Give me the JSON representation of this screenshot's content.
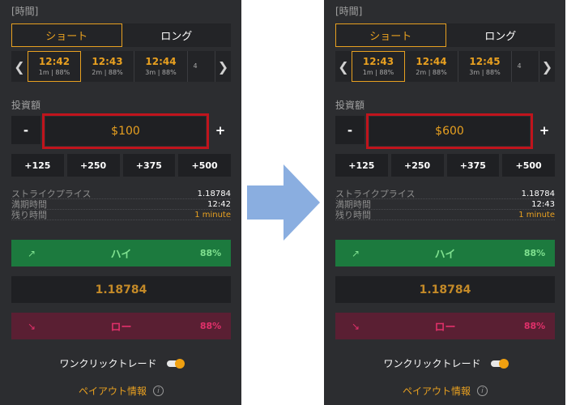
{
  "colors": {
    "panel_bg": "#2c2d30",
    "accent_orange": "#e8a020",
    "high_green": "#1c7a3e",
    "low_red": "#5a1f33",
    "highlight_red": "#c0141c",
    "arrow_blue": "#8aaee0"
  },
  "left": {
    "section_title": "[時間]",
    "tabs": {
      "short": "ショート",
      "long": "ロング"
    },
    "times": [
      {
        "time": "12:42",
        "sub": "1m | 88%"
      },
      {
        "time": "12:43",
        "sub": "2m | 88%"
      },
      {
        "time": "12:44",
        "sub": "3m | 88%"
      },
      {
        "time": "",
        "sub": "4"
      }
    ],
    "invest_label": "投資額",
    "minus": "-",
    "plus": "+",
    "amount": "$100",
    "quick": [
      "+125",
      "+250",
      "+375",
      "+500"
    ],
    "info": [
      {
        "label": "ストライクプライス",
        "value": "1.18784"
      },
      {
        "label": "満期時間",
        "value": "12:42"
      },
      {
        "label": "残り時間",
        "value": "1 minute"
      }
    ],
    "high": {
      "icon": "↗",
      "label": "ハイ",
      "pct": "88%"
    },
    "price": "1.18784",
    "low": {
      "icon": "↘",
      "label": "ロー",
      "pct": "88%"
    },
    "oneclick_label": "ワンクリックトレード",
    "payout_label": "ペイアウト情報",
    "info_glyph": "i"
  },
  "right": {
    "section_title": "[時間]",
    "tabs": {
      "short": "ショート",
      "long": "ロング"
    },
    "times": [
      {
        "time": "12:43",
        "sub": "1m | 88%"
      },
      {
        "time": "12:44",
        "sub": "2m | 88%"
      },
      {
        "time": "12:45",
        "sub": "3m | 88%"
      },
      {
        "time": "",
        "sub": "4"
      }
    ],
    "invest_label": "投資額",
    "minus": "-",
    "plus": "+",
    "amount": "$600",
    "quick": [
      "+125",
      "+250",
      "+375",
      "+500"
    ],
    "info": [
      {
        "label": "ストライクプライス",
        "value": "1.18784"
      },
      {
        "label": "満期時間",
        "value": "12:43"
      },
      {
        "label": "残り時間",
        "value": "1 minute"
      }
    ],
    "high": {
      "icon": "↗",
      "label": "ハイ",
      "pct": "88%"
    },
    "price": "1.18784",
    "low": {
      "icon": "↘",
      "label": "ロー",
      "pct": "88%"
    },
    "oneclick_label": "ワンクリックトレード",
    "payout_label": "ペイアウト情報",
    "info_glyph": "i"
  }
}
